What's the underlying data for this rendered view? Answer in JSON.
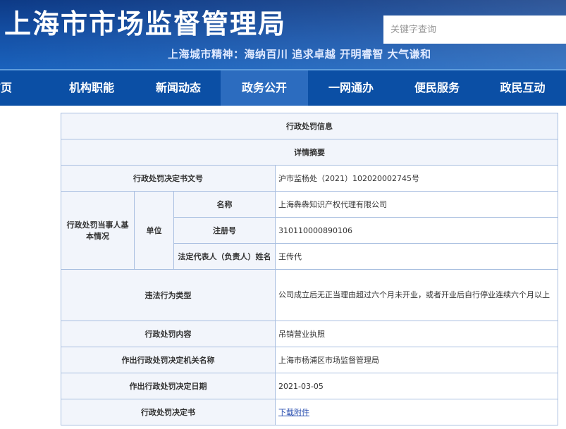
{
  "header": {
    "title": "上海市市场监督管理局",
    "search_placeholder": "关键字查询",
    "slogan": "上海城市精神：海纳百川  追求卓越  开明睿智  大气谦和"
  },
  "nav": {
    "items": [
      "首页",
      "机构职能",
      "新闻动态",
      "政务公开",
      "一网通办",
      "便民服务",
      "政民互动"
    ],
    "active": "政务公开"
  },
  "detail": {
    "title": "行政处罚信息",
    "summary": "详情摘要",
    "rows": {
      "doc_no_label": "行政处罚决定书文号",
      "doc_no": "沪市监杨处（2021）102020002745号",
      "party_label": "行政处罚当事人基本情况",
      "unit_label": "单位",
      "name_label": "名称",
      "name": "上海犇犇知识产权代理有限公司",
      "reg_label": "注册号",
      "reg_no": "310110000890106",
      "rep_label": "法定代表人（负责人）姓名",
      "rep": "王传代",
      "violation_label": "违法行为类型",
      "violation": "公司成立后无正当理由超过六个月未开业，或者开业后自行停业连续六个月以上",
      "content_label": "行政处罚内容",
      "content": "吊销营业执照",
      "authority_label": "作出行政处罚决定机关名称",
      "authority": "上海市杨浦区市场监督管理局",
      "date_label": "作出行政处罚决定日期",
      "date": "2021-03-05",
      "decision_label": "行政处罚决定书",
      "decision_link": "下载附件"
    }
  },
  "colors": {
    "header_bg": "#1552a8",
    "nav_bg": "#0b4fa5",
    "nav_active": "#2c6cbf",
    "table_border": "#a9bfe0",
    "table_label_bg": "#f2f5fb",
    "link": "#2a4fb0"
  }
}
